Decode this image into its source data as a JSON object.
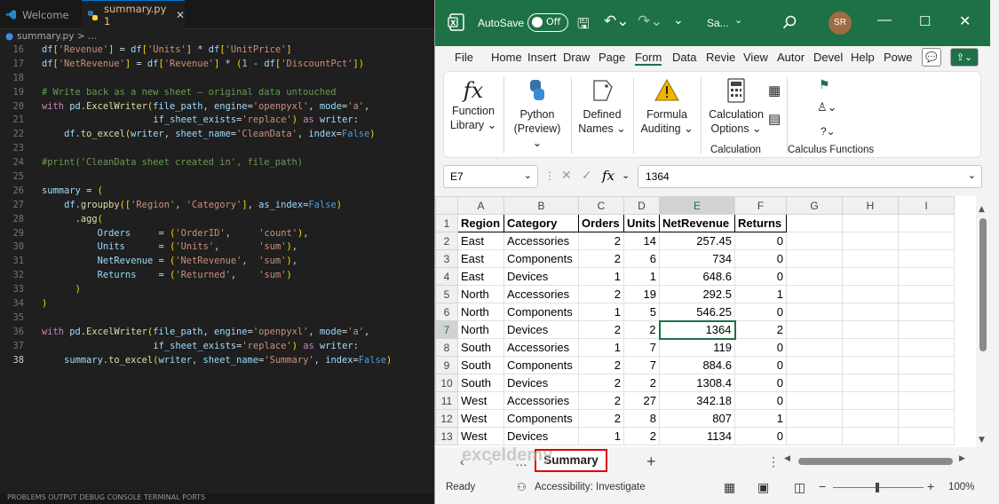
{
  "vscode": {
    "tabs": [
      {
        "label": "Welcome"
      },
      {
        "label": "summary.py 1"
      }
    ],
    "breadcrumb": "summary.py > ...",
    "code_lines": [
      {
        "num": "16",
        "text": "df['Revenue'] = df['Units'] * df['UnitPrice']"
      },
      {
        "num": "17",
        "text": "df['NetRevenue'] = df['Revenue'] * (1 - df['DiscountPct'])"
      },
      {
        "num": "18",
        "text": ""
      },
      {
        "num": "19",
        "text": "# Write back as a new sheet — original data untouched"
      },
      {
        "num": "20",
        "text": "with pd.ExcelWriter(file_path, engine='openpyxl', mode='a',"
      },
      {
        "num": "21",
        "text": "                    if_sheet_exists='replace') as writer:"
      },
      {
        "num": "22",
        "text": "    df.to_excel(writer, sheet_name='CleanData', index=False)"
      },
      {
        "num": "23",
        "text": ""
      },
      {
        "num": "24",
        "text": "#print('CleanData sheet created in', file_path)"
      },
      {
        "num": "25",
        "text": ""
      },
      {
        "num": "26",
        "text": "summary = ("
      },
      {
        "num": "27",
        "text": "    df.groupby(['Region', 'Category'], as_index=False)"
      },
      {
        "num": "28",
        "text": "      .agg("
      },
      {
        "num": "29",
        "text": "          Orders     = ('OrderID',     'count'),"
      },
      {
        "num": "30",
        "text": "          Units      = ('Units',       'sum'),"
      },
      {
        "num": "31",
        "text": "          NetRevenue = ('NetRevenue',  'sum'),"
      },
      {
        "num": "32",
        "text": "          Returns    = ('Returned',    'sum')"
      },
      {
        "num": "33",
        "text": "      )"
      },
      {
        "num": "34",
        "text": ")"
      },
      {
        "num": "35",
        "text": ""
      },
      {
        "num": "36",
        "text": "with pd.ExcelWriter(file_path, engine='openpyxl', mode='a',"
      },
      {
        "num": "37",
        "text": "                    if_sheet_exists='replace') as writer:"
      },
      {
        "num": "38",
        "text": "    summary.to_excel(writer, sheet_name='Summary', index=False)"
      }
    ],
    "current_line": "38",
    "bottom_panel": "PROBLEMS  OUTPUT  DEBUG CONSOLE  TERMINAL  PORTS"
  },
  "excel": {
    "autosave_label": "AutoSave",
    "autosave_state": "Off",
    "filename": "Sa...",
    "user_initials": "SR",
    "menu": [
      "File",
      "Home",
      "Insert",
      "Draw",
      "Page",
      "Form",
      "Data",
      "Revie",
      "View",
      "Autor",
      "Devel",
      "Help",
      "Powe"
    ],
    "active_menu": "Form",
    "ribbon": {
      "function_library": [
        "Function",
        "Library ⌄"
      ],
      "python": [
        "Python",
        "(Preview) ⌄"
      ],
      "defined_names": [
        "Defined",
        "Names ⌄"
      ],
      "formula_auditing": [
        "Formula",
        "Auditing ⌄"
      ],
      "calculation_options": [
        "Calculation",
        "Options ⌄"
      ],
      "calculation_group": "Calculation",
      "calculus_group": "Calculus Functions"
    },
    "name_box": "E7",
    "formula_value": "1364",
    "columns": [
      "A",
      "B",
      "C",
      "D",
      "E",
      "F",
      "G",
      "H",
      "I"
    ],
    "selected_col": "E",
    "header_row": [
      "Region",
      "Category",
      "Orders",
      "Units",
      "NetRevenue",
      "Returns"
    ],
    "rows": [
      [
        "East",
        "Accessories",
        "2",
        "14",
        "257.45",
        "0"
      ],
      [
        "East",
        "Components",
        "2",
        "6",
        "734",
        "0"
      ],
      [
        "East",
        "Devices",
        "1",
        "1",
        "648.6",
        "0"
      ],
      [
        "North",
        "Accessories",
        "2",
        "19",
        "292.5",
        "1"
      ],
      [
        "North",
        "Components",
        "1",
        "5",
        "546.25",
        "0"
      ],
      [
        "North",
        "Devices",
        "2",
        "2",
        "1364",
        "2"
      ],
      [
        "South",
        "Accessories",
        "1",
        "7",
        "119",
        "0"
      ],
      [
        "South",
        "Components",
        "2",
        "7",
        "884.6",
        "0"
      ],
      [
        "South",
        "Devices",
        "2",
        "2",
        "1308.4",
        "0"
      ],
      [
        "West",
        "Accessories",
        "2",
        "27",
        "342.18",
        "0"
      ],
      [
        "West",
        "Components",
        "2",
        "8",
        "807",
        "1"
      ],
      [
        "West",
        "Devices",
        "1",
        "2",
        "1134",
        "0"
      ]
    ],
    "sheet_tab": "Summary",
    "status_ready": "Ready",
    "status_accessibility": "Accessibility: Investigate",
    "zoom": "100%",
    "zoom_level": 1.0,
    "watermark": "exceldemy"
  }
}
